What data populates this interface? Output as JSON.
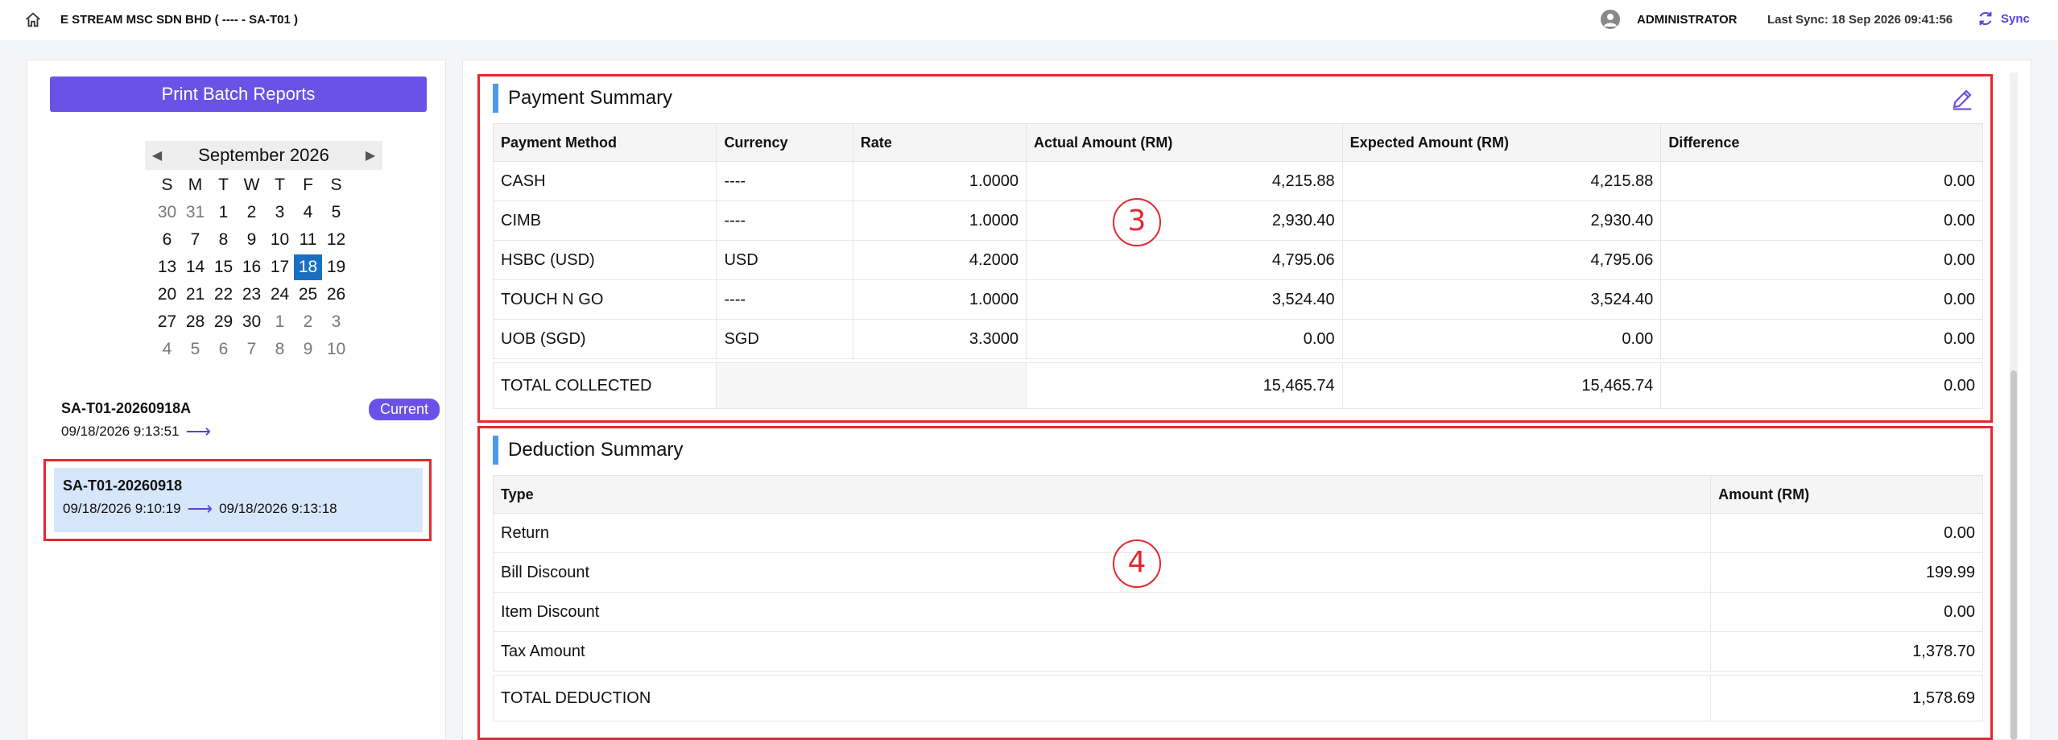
{
  "header": {
    "title": "E STREAM MSC SDN BHD ( ---- - SA-T01 )",
    "user": "ADMINISTRATOR",
    "last_sync": "Last Sync: 18 Sep 2026 09:41:56",
    "sync_label": "Sync",
    "icons": [
      "home-icon",
      "user-avatar-icon",
      "sync-icon"
    ]
  },
  "sidebar": {
    "print_button": "Print Batch Reports",
    "calendar": {
      "month_label": "September 2026",
      "weekdays": [
        "S",
        "M",
        "T",
        "W",
        "T",
        "F",
        "S"
      ],
      "weeks": [
        [
          "30",
          "31",
          "1",
          "2",
          "3",
          "4",
          "5"
        ],
        [
          "6",
          "7",
          "8",
          "9",
          "10",
          "11",
          "12"
        ],
        [
          "13",
          "14",
          "15",
          "16",
          "17",
          "18",
          "19"
        ],
        [
          "20",
          "21",
          "22",
          "23",
          "24",
          "25",
          "26"
        ],
        [
          "27",
          "28",
          "29",
          "30",
          "1",
          "2",
          "3"
        ],
        [
          "4",
          "5",
          "6",
          "7",
          "8",
          "9",
          "10"
        ]
      ],
      "selected_day": "18"
    },
    "batches": [
      {
        "name": "SA-T01-20260918A",
        "start": "09/18/2026 9:13:51",
        "end": "",
        "badge": "Current"
      },
      {
        "name": "SA-T01-20260918",
        "start": "09/18/2026 9:10:19",
        "end": "09/18/2026 9:13:18",
        "badge": ""
      }
    ]
  },
  "payment_summary": {
    "title": "Payment Summary",
    "columns": [
      "Payment Method",
      "Currency",
      "Rate",
      "Actual Amount (RM)",
      "Expected Amount (RM)",
      "Difference"
    ],
    "rows": [
      [
        "CASH",
        "----",
        "1.0000",
        "4,215.88",
        "4,215.88",
        "0.00"
      ],
      [
        "CIMB",
        "----",
        "1.0000",
        "2,930.40",
        "2,930.40",
        "0.00"
      ],
      [
        "HSBC (USD)",
        "USD",
        "4.2000",
        "4,795.06",
        "4,795.06",
        "0.00"
      ],
      [
        "TOUCH N GO",
        "----",
        "1.0000",
        "3,524.40",
        "3,524.40",
        "0.00"
      ],
      [
        "UOB (SGD)",
        "SGD",
        "3.3000",
        "0.00",
        "0.00",
        "0.00"
      ]
    ],
    "total": {
      "label": "TOTAL COLLECTED",
      "actual": "15,465.74",
      "expected": "15,465.74",
      "difference": "0.00"
    }
  },
  "deduction_summary": {
    "title": "Deduction Summary",
    "columns": [
      "Type",
      "Amount (RM)"
    ],
    "rows": [
      [
        "Return",
        "0.00"
      ],
      [
        "Bill Discount",
        "199.99"
      ],
      [
        "Item Discount",
        "0.00"
      ],
      [
        "Tax Amount",
        "1,378.70"
      ]
    ],
    "total": {
      "label": "TOTAL DEDUCTION",
      "amount": "1,578.69"
    }
  },
  "annotations": [
    "3",
    "4"
  ],
  "colors": {
    "accent": "#6b52e6",
    "selected_day": "#1a6fc1",
    "highlight_box": "#e2292f",
    "section_bar": "#4a9af0",
    "selected_batch_bg": "#d6e6fb"
  }
}
